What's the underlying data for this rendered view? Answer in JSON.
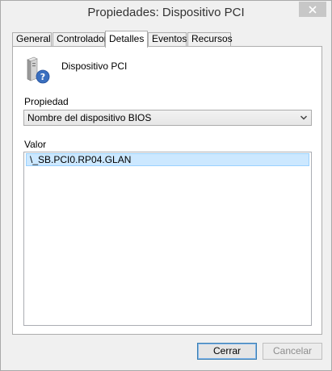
{
  "window": {
    "title": "Propiedades: Dispositivo PCI",
    "close_icon": "close-icon"
  },
  "tabs": [
    {
      "label": "General",
      "active": false
    },
    {
      "label": "Controlador",
      "active": false
    },
    {
      "label": "Detalles",
      "active": true
    },
    {
      "label": "Eventos",
      "active": false
    },
    {
      "label": "Recursos",
      "active": false
    }
  ],
  "details": {
    "device_icon": "unknown-device-icon",
    "device_name": "Dispositivo PCI",
    "property_label": "Propiedad",
    "property_selected": "Nombre del dispositivo BIOS",
    "value_label": "Valor",
    "values": [
      "\\_SB.PCI0.RP04.GLAN"
    ]
  },
  "buttons": {
    "ok": "Cerrar",
    "cancel": "Cancelar"
  }
}
